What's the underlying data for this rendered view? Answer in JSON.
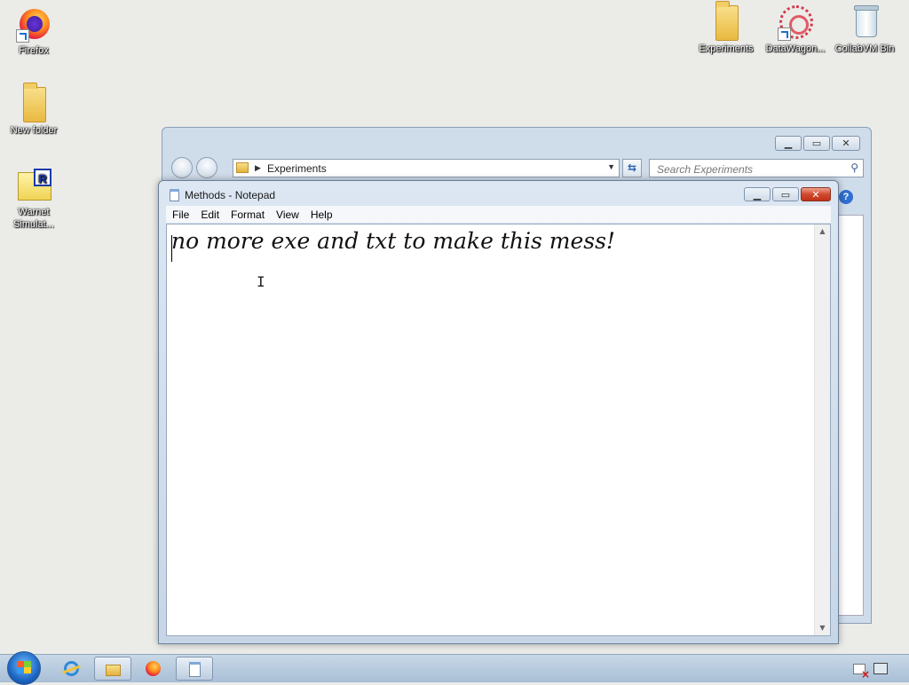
{
  "desktop": {
    "icons_left": [
      {
        "label": "Firefox"
      },
      {
        "label": "New folder"
      },
      {
        "label": "Warnet Simulat..."
      }
    ],
    "icons_right": [
      {
        "label": "Experiments"
      },
      {
        "label": "DataWagon..."
      },
      {
        "label": "CollabVM Bin"
      }
    ]
  },
  "explorer": {
    "address": "Experiments",
    "search_placeholder": "Search Experiments",
    "help_label": "?"
  },
  "notepad": {
    "title": "Methods - Notepad",
    "menu": [
      "File",
      "Edit",
      "Format",
      "View",
      "Help"
    ],
    "content": "no more exe and txt to make this mess!"
  },
  "window_buttons": {
    "minimize": "▁",
    "maximize": "▭",
    "close": "✕"
  }
}
